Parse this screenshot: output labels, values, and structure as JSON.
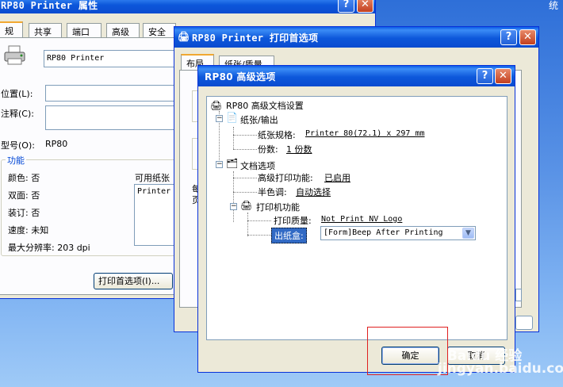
{
  "desktop": {
    "corner_text": "统"
  },
  "props_window": {
    "title": "RP80 Printer 属性",
    "tabs": [
      "常规",
      "共享",
      "端口",
      "高级",
      "安全"
    ],
    "printer_name": "RP80 Printer",
    "location_label": "位置(L):",
    "comment_label": "注释(C):",
    "model_label": "型号(O):",
    "model_value": "RP80",
    "features_title": "功能",
    "color": "颜色: 否",
    "duplex": "双面: 否",
    "staple": "装订: 否",
    "speed": "速度: 未知",
    "max_res": "最大分辨率: 203 dpi",
    "paper_avail_label": "可用纸张",
    "paper_avail_item": "Printer",
    "print_prefs_button": "打印首选项(I)..."
  },
  "prefs_window": {
    "title": "RP80 Printer 打印首选项",
    "tabs": [
      "布局",
      "纸张/质量"
    ],
    "partial_text_1": "每",
    "partial_text_2": "页"
  },
  "adv_dialog": {
    "title": "RP80 高级选项",
    "tree": {
      "root": "RP80 高级文档设置",
      "paper_output": "纸张/输出",
      "paper_size_label": "纸张规格:",
      "paper_size_value": "Printer 80(72.1) x 297 mm",
      "copies_label": "份数:",
      "copies_value": "1 份数",
      "doc_options": "文档选项",
      "adv_print_label": "高级打印功能:",
      "adv_print_value": "已启用",
      "halftone_label": "半色调:",
      "halftone_value": "自动选择",
      "printer_features": "打印机功能",
      "quality_label": "打印质量:",
      "quality_value": "Not Print NV Logo",
      "output_tray_label": "出纸盒:",
      "output_tray_value": "[Form]Beep After Printing"
    },
    "ok_button": "确定",
    "cancel_button": "取消"
  },
  "watermark": "Baidu 经验\njingyan.baidu.com",
  "colors": {
    "title_blue": "#0a5be7",
    "highlight": "#316ac5",
    "annotation_red": "#e02020"
  }
}
